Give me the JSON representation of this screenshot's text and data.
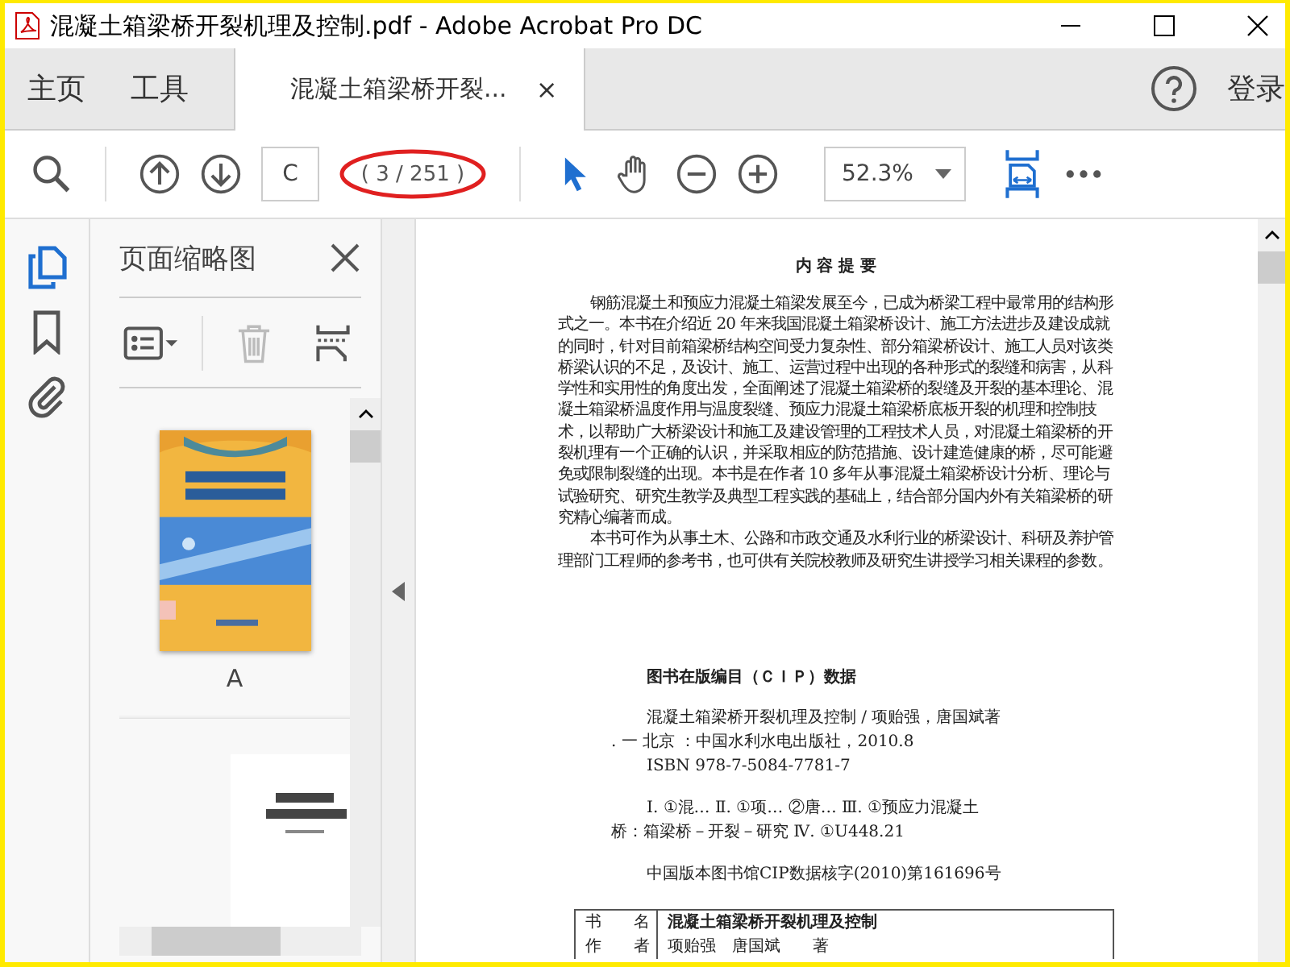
{
  "window": {
    "title": "混凝土箱梁桥开裂机理及控制.pdf - Adobe Acrobat Pro DC"
  },
  "nav": [
    {
      "label": "主页"
    },
    {
      "label": "工具"
    }
  ],
  "tabs": [
    {
      "label": "混凝土箱梁桥开裂...",
      "selected": true,
      "close": "×"
    }
  ],
  "sign_in": "登录",
  "toolbar": {
    "page_field": "C",
    "page_count": "( 3 / 251 )",
    "zoom": "52.3%"
  },
  "side_icons": [
    {
      "kind": "pages",
      "selected": true
    },
    {
      "kind": "bookmark",
      "selected": false
    },
    {
      "kind": "attach",
      "selected": false
    }
  ],
  "panel": {
    "title": "页面缩略图",
    "delete_disabled": true,
    "thumbnails": [
      {
        "kind": "picture",
        "label": "A"
      },
      {
        "kind": "picture"
      }
    ]
  },
  "document": {
    "heading": "内 容 提 要",
    "paragraphs": [
      "钢筋混凝土和预应力混凝土箱梁发展至今，已成为桥梁工程中最常用的结构形式之一。本书在介绍近 20 年来我国混凝土箱梁桥设计、施工方法进步及建设成就的同时，针对目前箱梁桥结构空间受力复杂性、部分箱梁桥设计、施工人员对该类桥梁认识的不足，及设计、施工、运营过程中出现的各种形式的裂缝和病害，从科学性和实用性的角度出发，全面阐述了混凝土箱梁桥的裂缝及开裂的基本理论、混凝土箱梁桥温度作用与温度裂缝、预应力混凝土箱梁桥底板开裂的机理和控制技术，以帮助广大桥梁设计和施工及建设管理的工程技术人员，对混凝土箱梁桥的开裂机理有一个正确的认识，并采取相应的防范措施、设计建造健康的桥，尽可能避免或限制裂缝的出现。本书是在作者 10 多年从事混凝土箱梁桥设计分析、理论与试验研究、研究生教学及典型工程实践的基础上，结合部分国内外有关箱梁桥的研究精心编著而成。",
      "本书可作为从事土木、公路和市政交通及水利行业的桥梁设计、科研及养护管理部门工程师的参考书，也可供有关院校教师及研究生讲授学习相关课程的参数。"
    ],
    "cip_heading": "图书在版编目（ＣＩＰ）数据",
    "cip_blocks": [
      {
        "lines": [
          {
            "kind": "indent",
            "text": "混凝土箱梁桥开裂机理及控制 / 项贻强，唐国斌著"
          },
          {
            "kind": "hang",
            "text": ". 一 北京 ：中国水利水电出版社，2010.8"
          },
          {
            "kind": "indent",
            "text": "ISBN 978-7-5084-7781-7"
          }
        ]
      },
      {
        "lines": [
          {
            "kind": "indent",
            "text": "Ⅰ. ①混… Ⅱ. ①项… ②唐… Ⅲ. ①预应力混凝土"
          },
          {
            "kind": "hang",
            "text": "桥：箱梁桥－开裂－研究 Ⅳ. ①U448.21"
          }
        ]
      },
      {
        "lines": [
          {
            "kind": "indent",
            "text": "中国版本图书馆CIP数据核字(2010)第161696号"
          }
        ]
      }
    ],
    "info_rows": [
      {
        "label": "书　　名",
        "value": "混凝土箱梁桥开裂机理及控制"
      },
      {
        "label": "作　　者",
        "value": "项贻强　唐国斌　　著"
      }
    ]
  }
}
